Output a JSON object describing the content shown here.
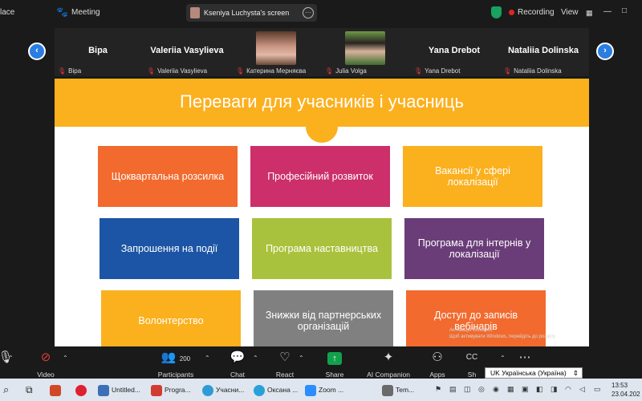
{
  "top_bar": {
    "left_cut_text": "lace",
    "meeting_label": "Meeting",
    "screen_share_label": "Kseniya Luchysta's screen",
    "more_glyph": "···",
    "recording_label": "Recording",
    "view_label": "View",
    "colors": {
      "shield": "#19a15f",
      "rec": "#e02424"
    }
  },
  "participants": [
    {
      "name": "Віра",
      "footer": "Віра",
      "has_photo": false
    },
    {
      "name": "Valeriia Vasylieva",
      "footer": "Valeriia Vasylieva",
      "has_photo": false
    },
    {
      "name": "",
      "footer": "Катерина Мерняєва",
      "has_photo": true
    },
    {
      "name": "",
      "footer": "Julia Volga",
      "has_photo": true
    },
    {
      "name": "Yana Drebot",
      "footer": "Yana Drebot",
      "has_photo": false
    },
    {
      "name": "Nataliia Dolinska",
      "footer": "Nataliia Dolinska",
      "has_photo": false
    }
  ],
  "nav": {
    "prev": "‹",
    "next": "›"
  },
  "slide": {
    "title": "Переваги для учасників і учасниць",
    "boxes": [
      {
        "label": "Щоквартальна розсилка",
        "color": "#f26a2e"
      },
      {
        "label": "Професійний розвиток",
        "color": "#cc2f69"
      },
      {
        "label": "Вакансії у сфері локалізації",
        "color": "#fbb01e"
      },
      {
        "label": "Запрошення на події",
        "color": "#1c55a5"
      },
      {
        "label": "Програма наставництва",
        "color": "#a9c23d"
      },
      {
        "label": "Програма для інтернів у локалізації",
        "color": "#6a3d78"
      },
      {
        "label": "Волонтерство",
        "color": "#fbb01e"
      },
      {
        "label": "Знижки від партнерських організацій",
        "color": "#808080"
      },
      {
        "label": "Доступ до записів вебінарів",
        "color": "#f26a2e"
      }
    ],
    "ghost_text_1": "Активація Windows",
    "ghost_text_2": "Щоб активувати Windows, перейдіть до розділу"
  },
  "toolbar": {
    "mic_label": "",
    "video_label": "Video",
    "participants_label": "Participants",
    "participants_count": "200",
    "chat_label": "Chat",
    "react_label": "React",
    "share_label": "Share",
    "ai_label": "AI Companion",
    "apps_label": "Apps",
    "cc_label": "Sh",
    "language_popup": "UK Українська (Україна)"
  },
  "taskbar": {
    "items": [
      {
        "label": "Untitled...",
        "color": "#3b6fb6"
      },
      {
        "label": "Progra...",
        "color": "#d23b2f"
      },
      {
        "label": "Учасни...",
        "color": "#2e9bd6"
      },
      {
        "label": "Оксана ...",
        "color": "#2aa0d8"
      },
      {
        "label": "Zoom ...",
        "color": "#2d8cff"
      },
      {
        "label": "Tem...",
        "color": "#6a6a6a"
      }
    ],
    "time": "13:53",
    "date": "23.04.202"
  }
}
